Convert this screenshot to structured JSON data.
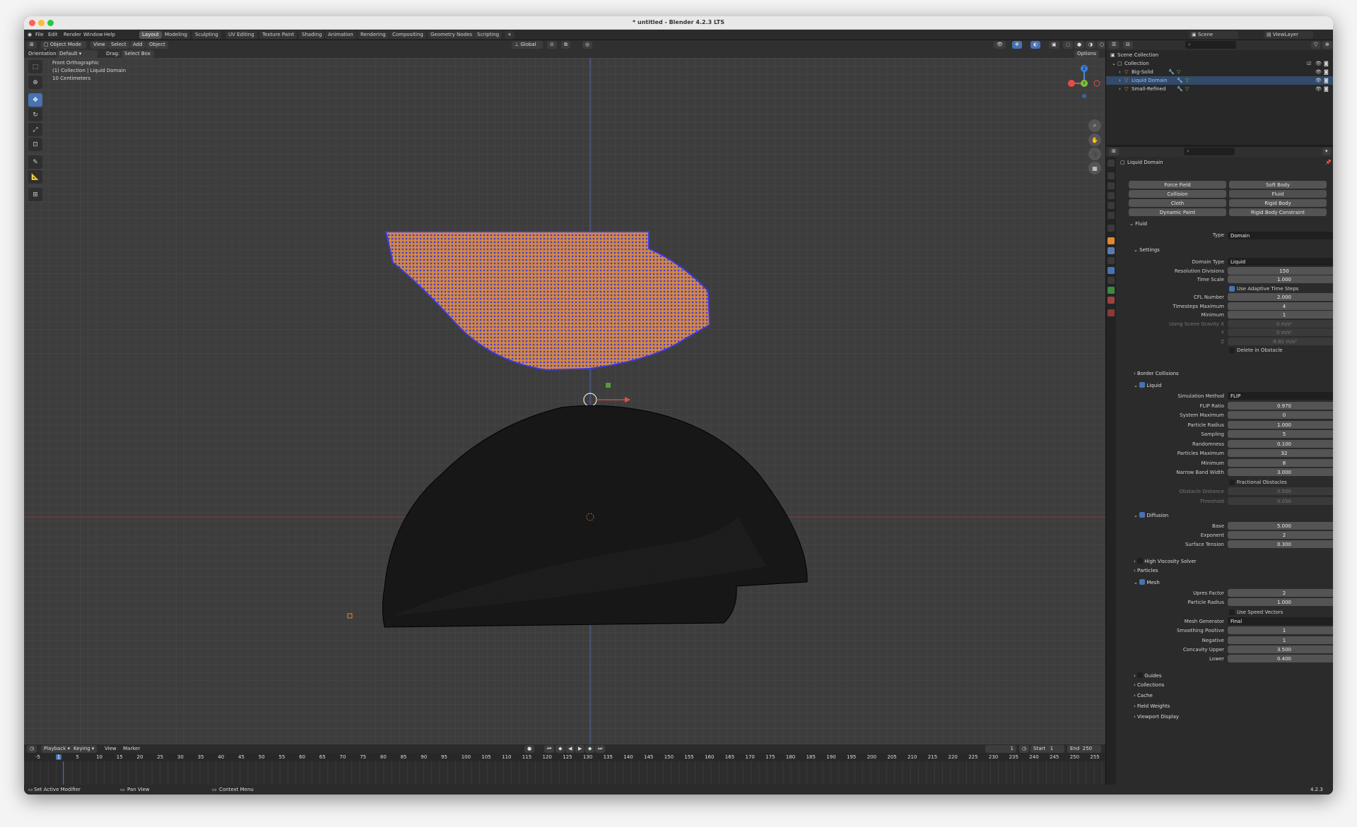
{
  "window": {
    "title": "* untitled - Blender 4.2.3 LTS"
  },
  "menu": [
    "File",
    "Edit",
    "Render",
    "Window",
    "Help"
  ],
  "workspaces": [
    "Layout",
    "Modeling",
    "Sculpting",
    "UV Editing",
    "Texture Paint",
    "Shading",
    "Animation",
    "Rendering",
    "Compositing",
    "Geometry Nodes",
    "Scripting"
  ],
  "active_workspace": "Layout",
  "topright": {
    "scene": "Scene",
    "viewlayer": "ViewLayer"
  },
  "viewport_header": {
    "mode": "Object Mode",
    "menus": [
      "View",
      "Select",
      "Add",
      "Object"
    ],
    "transform": "Global",
    "options": "Options"
  },
  "tool_settings": {
    "orientation_label": "Orientation:",
    "orientation_value": "Default",
    "drag_label": "Drag:",
    "drag_value": "Select Box"
  },
  "overlay": {
    "view": "Front Orthographic",
    "collection": "(1) Collection | Liquid Domain",
    "scale": "10 Centimeters"
  },
  "gizmo": {
    "z": "Z",
    "x": "X",
    "y": "Y"
  },
  "outliner": {
    "root": "Scene Collection",
    "collection": "Collection",
    "objects": [
      "Big-Solid",
      "Liquid Domain",
      "Small-Refined"
    ]
  },
  "properties": {
    "object_name": "Liquid Domain",
    "physics_buttons": [
      [
        "Force Field",
        "Soft Body"
      ],
      [
        "Collision",
        "Fluid"
      ],
      [
        "Cloth",
        "Rigid Body"
      ],
      [
        "Dynamic Paint",
        "Rigid Body Constraint"
      ]
    ],
    "fluid_title": "Fluid",
    "type_label": "Type",
    "type_value": "Domain",
    "settings_title": "Settings",
    "fields": [
      {
        "label": "Domain Type",
        "value": "Liquid",
        "kind": "select"
      },
      {
        "label": "Resolution Divisions",
        "value": "150"
      },
      {
        "label": "Time Scale",
        "value": "1.000"
      },
      {
        "label": "",
        "value": "Use Adaptive Time Steps",
        "kind": "check"
      },
      {
        "label": "CFL Number",
        "value": "2.000"
      },
      {
        "label": "Timesteps Maximum",
        "value": "4"
      },
      {
        "label": "Minimum",
        "value": "1"
      },
      {
        "label": "Using Scene Gravity X",
        "value": "0 m/s²",
        "kind": "dim"
      },
      {
        "label": "Y",
        "value": "0 m/s²",
        "kind": "dim"
      },
      {
        "label": "Z",
        "value": "-9.81 m/s²",
        "kind": "dim"
      },
      {
        "label": "",
        "value": "Delete in Obstacle",
        "kind": "check"
      }
    ],
    "border_collisions": "Border Collisions",
    "liquid_title": "Liquid",
    "liquid_fields": [
      {
        "label": "Simulation Method",
        "value": "FLIP",
        "kind": "select"
      },
      {
        "label": "FLIP Ratio",
        "value": "0.970"
      },
      {
        "label": "System Maximum",
        "value": "0"
      },
      {
        "label": "Particle Radius",
        "value": "1.000"
      },
      {
        "label": "Sampling",
        "value": "5"
      },
      {
        "label": "Randomness",
        "value": "0.100"
      },
      {
        "label": "Particles Maximum",
        "value": "32"
      },
      {
        "label": "Minimum",
        "value": "8"
      },
      {
        "label": "Narrow Band Width",
        "value": "3.000"
      },
      {
        "label": "",
        "value": "Fractional Obstacles",
        "kind": "check"
      },
      {
        "label": "Obstacle Distance",
        "value": "0.500",
        "kind": "dim"
      },
      {
        "label": "Threshold",
        "value": "0.050",
        "kind": "dim"
      }
    ],
    "diffusion_title": "Diffusion",
    "diffusion_fields": [
      {
        "label": "Base",
        "value": "5.000"
      },
      {
        "label": "Exponent",
        "value": "2"
      },
      {
        "label": "Surface Tension",
        "value": "0.300"
      }
    ],
    "high_viscosity": "High Viscosity Solver",
    "particles": "Particles",
    "mesh_title": "Mesh",
    "mesh_fields": [
      {
        "label": "Upres Factor",
        "value": "2"
      },
      {
        "label": "Particle Radius",
        "value": "1.000"
      },
      {
        "label": "",
        "value": "Use Speed Vectors",
        "kind": "check"
      },
      {
        "label": "Mesh Generator",
        "value": "Final",
        "kind": "select"
      },
      {
        "label": "Smoothing Positive",
        "value": "1"
      },
      {
        "label": "Negative",
        "value": "1"
      },
      {
        "label": "Concavity Upper",
        "value": "3.500"
      },
      {
        "label": "Lower",
        "value": "0.400"
      }
    ],
    "bottom_sections": [
      "Guides",
      "Collections",
      "Cache",
      "Field Weights",
      "Viewport Display"
    ]
  },
  "timeline": {
    "menus": [
      "Playback",
      "Keying",
      "View",
      "Marker"
    ],
    "current": "1",
    "start_label": "Start",
    "start": "1",
    "end_label": "End",
    "end": "250",
    "ticks": [
      "-5",
      "1",
      "5",
      "10",
      "15",
      "20",
      "25",
      "30",
      "35",
      "40",
      "45",
      "50",
      "55",
      "60",
      "65",
      "70",
      "75",
      "80",
      "85",
      "90",
      "95",
      "100",
      "105",
      "110",
      "115",
      "120",
      "125",
      "130",
      "135",
      "140",
      "145",
      "150",
      "155",
      "160",
      "165",
      "170",
      "175",
      "180",
      "185",
      "190",
      "195",
      "200",
      "205",
      "210",
      "215",
      "220",
      "225",
      "230",
      "235",
      "240",
      "245",
      "250",
      "255"
    ]
  },
  "statusbar": {
    "left": "Set Active Modifier",
    "middle": "Pan View",
    "right": "Context Menu",
    "version": "4.2.3"
  },
  "colors": {
    "accent": "#4772b3",
    "liquid_orange": "#d98a4a",
    "liquid_blue": "#3a3ad8",
    "mesh_black": "#121212"
  }
}
